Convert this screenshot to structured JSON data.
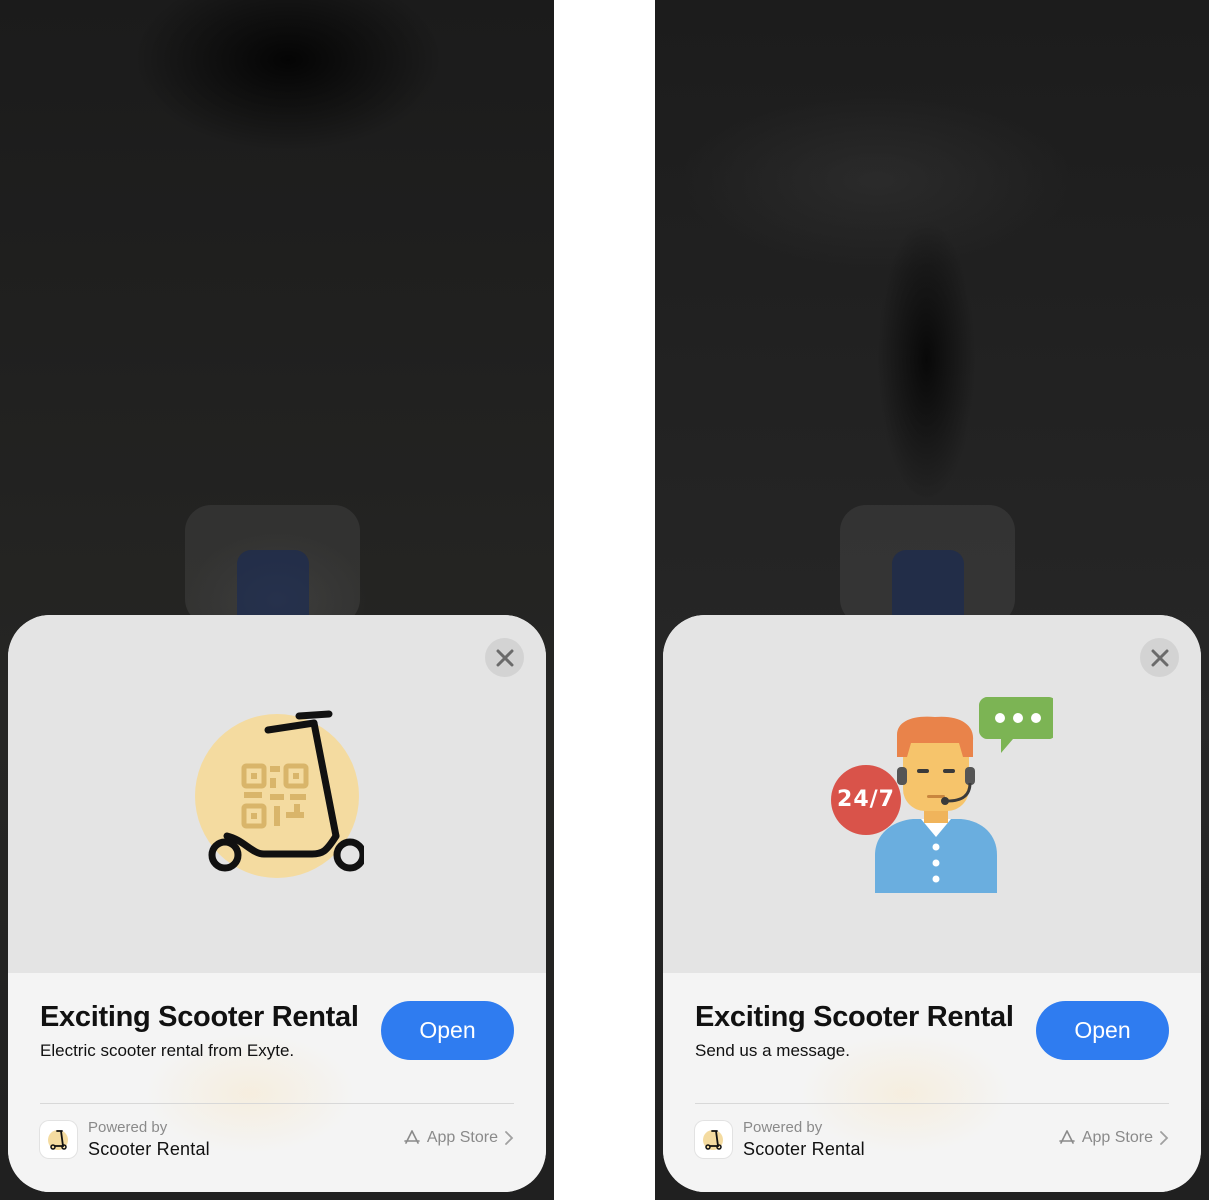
{
  "screens": [
    {
      "id": "scooter",
      "title": "Exciting Scooter Rental",
      "subtitle": "Electric scooter rental from Exyte.",
      "open_label": "Open",
      "powered_by": "Powered by",
      "app_name": "Scooter Rental",
      "store_label": "App Store",
      "illustration": "scooter-qr-icon"
    },
    {
      "id": "support",
      "title": "Exciting Scooter Rental",
      "subtitle": "Send us a message.",
      "open_label": "Open",
      "powered_by": "Powered by",
      "app_name": "Scooter Rental",
      "store_label": "App Store",
      "illustration": "support-agent-icon",
      "badge_text": "24/7"
    }
  ],
  "colors": {
    "accent": "#2f7cf0",
    "hero_bg": "#e4e4e4",
    "card_bg": "#f4f4f4"
  }
}
